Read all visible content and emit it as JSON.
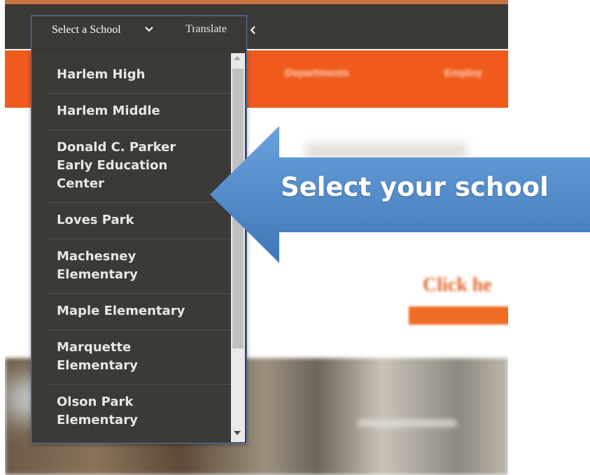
{
  "nav": {
    "select_school_label": "Select a School",
    "translate_label": "Translate",
    "chevron_icon": "chevron-down-icon",
    "translate_icon": "chevron-left-icon"
  },
  "background": {
    "nav_items": [
      "Departments",
      "Employ"
    ],
    "click_text": "Click he"
  },
  "dropdown": {
    "items": [
      {
        "label": "Harlem High"
      },
      {
        "label": "Harlem Middle"
      },
      {
        "label": "Donald C. Parker\nEarly Education\nCenter"
      },
      {
        "label": "Loves Park"
      },
      {
        "label": "Machesney\nElementary"
      },
      {
        "label": "Maple Elementary"
      },
      {
        "label": "Marquette\nElementary"
      },
      {
        "label": "Olson Park\nElementary"
      }
    ]
  },
  "callout": {
    "text": "Select your school",
    "color": "#4f86c6"
  },
  "colors": {
    "orange": "#f05a1c",
    "dark": "#3b3a36",
    "border": "#5b79b8"
  }
}
